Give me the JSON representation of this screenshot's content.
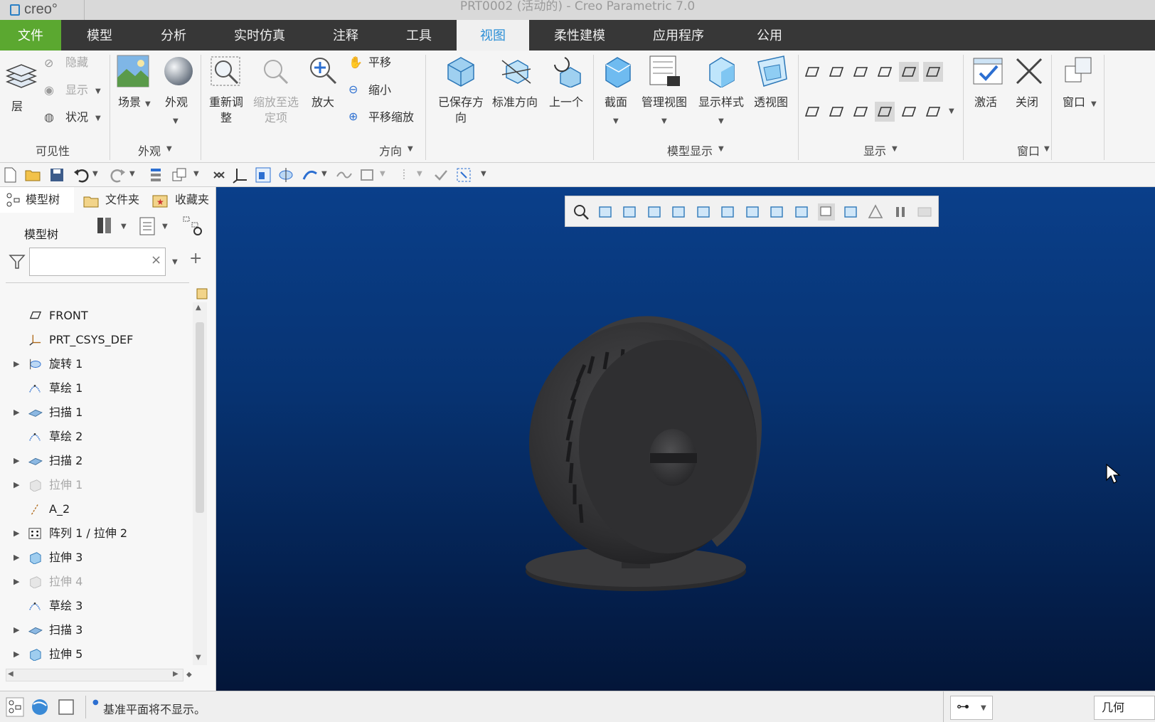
{
  "app": {
    "logo_text": "creo°",
    "window_title": "PRT0002 (活动的) - Creo Parametric 7.0"
  },
  "menu": {
    "tabs": [
      "文件",
      "模型",
      "分析",
      "实时仿真",
      "注释",
      "工具",
      "视图",
      "柔性建模",
      "应用程序",
      "公用"
    ],
    "active": "视图"
  },
  "ribbon": {
    "visibility": {
      "layer": "层",
      "hide": "隐藏",
      "show": "显示",
      "status": "状况",
      "group": "可见性"
    },
    "appearance": {
      "scene": "场景",
      "appearance": "外观",
      "group": "外观"
    },
    "orientation": {
      "refit": "重新调整",
      "zoom_to_selected": "缩放至选定项",
      "zoom_in": "放大",
      "pan": "平移",
      "zoom_out": "缩小",
      "pan_zoom": "平移缩放",
      "group": "方向"
    },
    "model_display": {
      "saved_orientations": "已保存方向",
      "standard_orientation": "标准方向",
      "previous": "上一个",
      "section": "截面",
      "manage_views": "管理视图",
      "display_style": "显示样式",
      "perspective": "透视图",
      "group": "模型显示"
    },
    "show": {
      "group": "显示"
    },
    "window": {
      "activate": "激活",
      "close": "关闭",
      "windows": "窗口",
      "group": "窗口"
    }
  },
  "left_panel": {
    "tabs": [
      "模型树",
      "文件夹",
      "收藏夹"
    ],
    "tree_header": "模型树",
    "search_placeholder": "",
    "tree": [
      {
        "label": "FRONT",
        "icon": "plane-icon",
        "expand": false,
        "dim": false
      },
      {
        "label": "PRT_CSYS_DEF",
        "icon": "csys-icon",
        "expand": false,
        "dim": false
      },
      {
        "label": "旋转 1",
        "icon": "revolve-icon",
        "expand": true,
        "dim": false
      },
      {
        "label": "草绘 1",
        "icon": "sketch-icon",
        "expand": false,
        "dim": false
      },
      {
        "label": "扫描 1",
        "icon": "sweep-icon",
        "expand": true,
        "dim": false
      },
      {
        "label": "草绘 2",
        "icon": "sketch-icon",
        "expand": false,
        "dim": false
      },
      {
        "label": "扫描 2",
        "icon": "sweep-icon",
        "expand": true,
        "dim": false
      },
      {
        "label": "拉伸 1",
        "icon": "extrude-icon",
        "expand": true,
        "dim": true
      },
      {
        "label": "A_2",
        "icon": "axis-icon",
        "expand": false,
        "dim": false
      },
      {
        "label": "阵列 1 / 拉伸 2",
        "icon": "pattern-icon",
        "expand": true,
        "dim": false
      },
      {
        "label": "拉伸 3",
        "icon": "extrude-icon",
        "expand": true,
        "dim": false
      },
      {
        "label": "拉伸 4",
        "icon": "extrude-icon",
        "expand": true,
        "dim": true
      },
      {
        "label": "草绘 3",
        "icon": "sketch-icon",
        "expand": false,
        "dim": false
      },
      {
        "label": "扫描 3",
        "icon": "sweep-icon",
        "expand": true,
        "dim": false
      },
      {
        "label": "拉伸 5",
        "icon": "extrude-icon",
        "expand": true,
        "dim": false
      }
    ]
  },
  "status": {
    "message": "基准平面将不显示。",
    "filter": "几何"
  },
  "colors": {
    "file_tab": "#5ba830",
    "menubar": "#373737",
    "active_tab_text": "#2c8fd6",
    "viewport_top": "#0a3f8a",
    "viewport_bottom": "#031639"
  }
}
